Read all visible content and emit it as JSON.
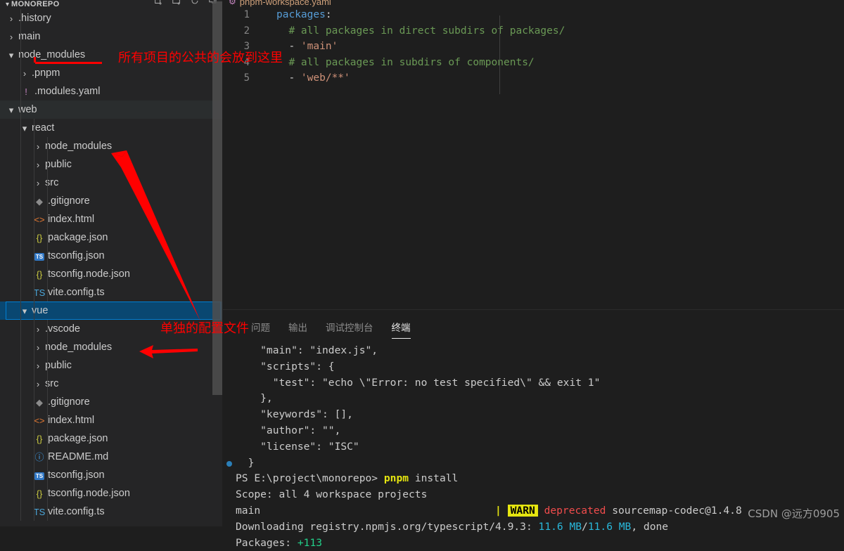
{
  "sidebar": {
    "title": "MONOREPO",
    "twisty_open": "⌄",
    "actions": [
      {
        "name": "new-file-icon",
        "label": "New File"
      },
      {
        "name": "new-folder-icon",
        "label": "New Folder"
      },
      {
        "name": "refresh-icon",
        "label": "Refresh Explorer"
      },
      {
        "name": "collapse-all-icon",
        "label": "Collapse Folders in Explorer"
      }
    ],
    "tree": [
      {
        "label": ".history",
        "depth": 1,
        "kind": "folder",
        "open": false,
        "state": "normal"
      },
      {
        "label": "main",
        "depth": 1,
        "kind": "folder",
        "open": false,
        "state": "normal"
      },
      {
        "label": "node_modules",
        "depth": 1,
        "kind": "folder",
        "open": true,
        "state": "normal"
      },
      {
        "label": ".pnpm",
        "depth": 2,
        "kind": "folder",
        "open": false,
        "state": "normal"
      },
      {
        "label": ".modules.yaml",
        "depth": 2,
        "kind": "yaml",
        "state": "normal"
      },
      {
        "label": "web",
        "depth": 1,
        "kind": "folder",
        "open": true,
        "state": "hover"
      },
      {
        "label": "react",
        "depth": 2,
        "kind": "folder",
        "open": true,
        "state": "normal"
      },
      {
        "label": "node_modules",
        "depth": 3,
        "kind": "folder",
        "open": false,
        "state": "normal"
      },
      {
        "label": "public",
        "depth": 3,
        "kind": "folder",
        "open": false,
        "state": "normal"
      },
      {
        "label": "src",
        "depth": 3,
        "kind": "folder",
        "open": false,
        "state": "normal"
      },
      {
        "label": ".gitignore",
        "depth": 3,
        "kind": "git",
        "state": "normal"
      },
      {
        "label": "index.html",
        "depth": 3,
        "kind": "html",
        "state": "normal"
      },
      {
        "label": "package.json",
        "depth": 3,
        "kind": "json",
        "state": "normal"
      },
      {
        "label": "tsconfig.json",
        "depth": 3,
        "kind": "tsbox",
        "state": "normal"
      },
      {
        "label": "tsconfig.node.json",
        "depth": 3,
        "kind": "json",
        "state": "normal"
      },
      {
        "label": "vite.config.ts",
        "depth": 3,
        "kind": "ts",
        "state": "normal"
      },
      {
        "label": "vue",
        "depth": 2,
        "kind": "folder",
        "open": true,
        "state": "selected"
      },
      {
        "label": ".vscode",
        "depth": 3,
        "kind": "folder",
        "open": false,
        "state": "normal"
      },
      {
        "label": "node_modules",
        "depth": 3,
        "kind": "folder",
        "open": false,
        "state": "normal"
      },
      {
        "label": "public",
        "depth": 3,
        "kind": "folder",
        "open": false,
        "state": "normal"
      },
      {
        "label": "src",
        "depth": 3,
        "kind": "folder",
        "open": false,
        "state": "normal"
      },
      {
        "label": ".gitignore",
        "depth": 3,
        "kind": "git",
        "state": "normal"
      },
      {
        "label": "index.html",
        "depth": 3,
        "kind": "html",
        "state": "normal"
      },
      {
        "label": "package.json",
        "depth": 3,
        "kind": "json",
        "state": "normal"
      },
      {
        "label": "README.md",
        "depth": 3,
        "kind": "md",
        "state": "normal"
      },
      {
        "label": "tsconfig.json",
        "depth": 3,
        "kind": "tsbox",
        "state": "normal"
      },
      {
        "label": "tsconfig.node.json",
        "depth": 3,
        "kind": "json",
        "state": "normal"
      },
      {
        "label": "vite.config.ts",
        "depth": 3,
        "kind": "ts",
        "state": "normal"
      }
    ]
  },
  "editor": {
    "tab_label": "pnpm-workspace.yaml",
    "tab_icon": "yaml-file-icon",
    "lines": [
      {
        "num": "1",
        "parts": [
          {
            "t": "packages",
            "c": "tok-key"
          },
          {
            "t": ":",
            "c": "tok-punc"
          }
        ]
      },
      {
        "num": "2",
        "parts": [
          {
            "t": "  # all packages in direct subdirs of packages/",
            "c": "tok-cmt"
          }
        ]
      },
      {
        "num": "3",
        "parts": [
          {
            "t": "  - ",
            "c": "tok-dash"
          },
          {
            "t": "'main'",
            "c": "tok-str"
          }
        ]
      },
      {
        "num": "4",
        "parts": [
          {
            "t": "  # all packages in subdirs of components/",
            "c": "tok-cmt"
          }
        ]
      },
      {
        "num": "5",
        "parts": [
          {
            "t": "  - ",
            "c": "tok-dash"
          },
          {
            "t": "'web/**'",
            "c": "tok-str"
          }
        ]
      }
    ]
  },
  "panel": {
    "tabs": [
      {
        "label": "问题",
        "active": false
      },
      {
        "label": "输出",
        "active": false
      },
      {
        "label": "调试控制台",
        "active": false
      },
      {
        "label": "终端",
        "active": true
      }
    ],
    "terminal_lines": [
      {
        "bullet": false,
        "parts": [
          {
            "t": "    \"main\": \"index.js\",",
            "c": "t-str"
          }
        ]
      },
      {
        "bullet": false,
        "parts": [
          {
            "t": "    \"scripts\": {",
            "c": "t-str"
          }
        ]
      },
      {
        "bullet": false,
        "parts": [
          {
            "t": "      \"test\": \"echo \\\"Error: no test specified\\\" && exit 1\"",
            "c": "t-str"
          }
        ]
      },
      {
        "bullet": false,
        "parts": [
          {
            "t": "    },",
            "c": "t-str"
          }
        ]
      },
      {
        "bullet": false,
        "parts": [
          {
            "t": "    \"keywords\": [],",
            "c": "t-str"
          }
        ]
      },
      {
        "bullet": false,
        "parts": [
          {
            "t": "    \"author\": \"\",",
            "c": "t-str"
          }
        ]
      },
      {
        "bullet": false,
        "parts": [
          {
            "t": "    \"license\": \"ISC\"",
            "c": "t-str"
          }
        ]
      },
      {
        "bullet": true,
        "parts": [
          {
            "t": "  }",
            "c": "t-str"
          }
        ]
      },
      {
        "bullet": false,
        "parts": [
          {
            "t": "PS E:\\project\\monorepo> ",
            "c": "t-str"
          },
          {
            "t": "pnpm",
            "c": "t-yellow"
          },
          {
            "t": " install",
            "c": "t-str"
          }
        ]
      },
      {
        "bullet": false,
        "parts": [
          {
            "t": "Scope: all 4 workspace projects",
            "c": "t-str"
          }
        ]
      },
      {
        "bullet": false,
        "parts": [
          {
            "t": "main                                      ",
            "c": "t-str"
          },
          {
            "t": "|",
            "c": "t-yellow"
          },
          {
            "t": " ",
            "c": "t-str"
          },
          {
            "t": "WARN",
            "c": "warnbox"
          },
          {
            "t": " ",
            "c": "t-str"
          },
          {
            "t": "deprecated",
            "c": "t-red"
          },
          {
            "t": " sourcemap-codec@1.4.8",
            "c": "t-str"
          }
        ]
      },
      {
        "bullet": false,
        "parts": [
          {
            "t": "Downloading registry.npmjs.org/typescript/4.9.3: ",
            "c": "t-str"
          },
          {
            "t": "11.6 MB",
            "c": "t-cyan"
          },
          {
            "t": "/",
            "c": "t-str"
          },
          {
            "t": "11.6 MB",
            "c": "t-cyan"
          },
          {
            "t": ", done",
            "c": "t-str"
          }
        ]
      },
      {
        "bullet": false,
        "parts": [
          {
            "t": "Packages: ",
            "c": "t-str"
          },
          {
            "t": "+113",
            "c": "t-green"
          }
        ]
      }
    ]
  },
  "annotations": {
    "note_top": "所有项目的公共的会放到这里",
    "note_bottom": "单独的配置文件",
    "color": "#ff0000"
  },
  "watermark": "CSDN @远方0905"
}
